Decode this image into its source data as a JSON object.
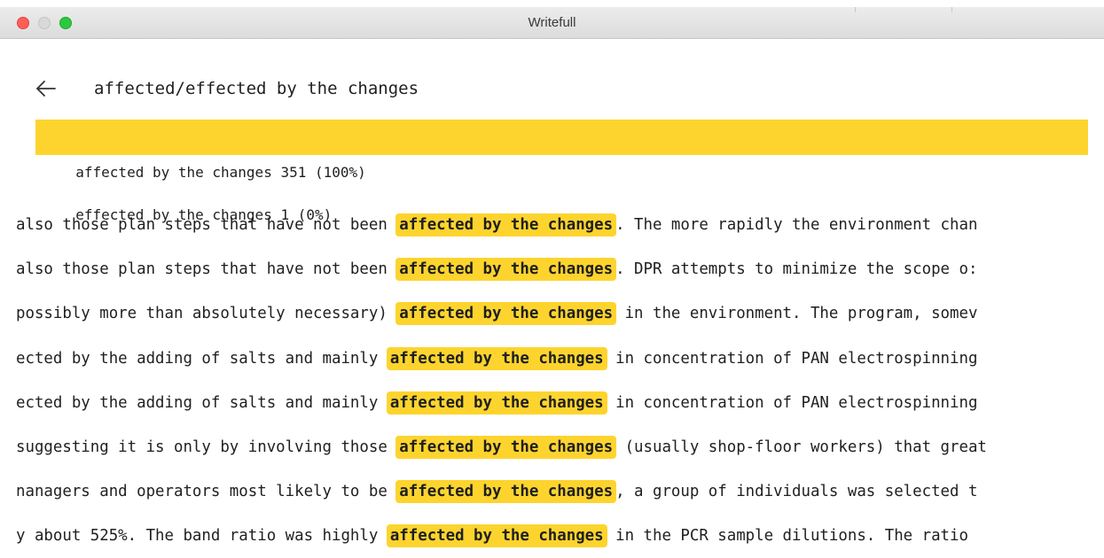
{
  "window": {
    "title": "Writefull",
    "colors": {
      "close": "#fd5f57",
      "minimize": "#d9d9d9",
      "zoom": "#2cc840"
    }
  },
  "header": {
    "back_icon": "left-arrow-icon",
    "query": "affected/effected by the changes"
  },
  "options": [
    {
      "label": "affected by the changes 351 (100%)",
      "selected": true
    },
    {
      "label": "effected by the changes 1 (0%)",
      "selected": false
    }
  ],
  "highlight_color": "#fdd42e",
  "examples": [
    {
      "before": "also those plan steps that have not been ",
      "match": "affected by the changes",
      "after": ". The more rapidly the environment chan"
    },
    {
      "before": "also those plan steps that have not been ",
      "match": "affected by the changes",
      "after": ". DPR attempts to minimize the scope o:"
    },
    {
      "before": "possibly more than absolutely necessary) ",
      "match": "affected by the changes",
      "after": " in the environment. The program, somev"
    },
    {
      "before": "ected by the adding of salts and mainly ",
      "match": "affected by the changes",
      "after": " in concentration of PAN electrospinning"
    },
    {
      "before": "ected by the adding of salts and mainly ",
      "match": "affected by the changes",
      "after": " in concentration of PAN electrospinning"
    },
    {
      "before": "suggesting it is only by involving those ",
      "match": "affected by the changes",
      "after": " (usually shop-floor workers) that great"
    },
    {
      "before": "nanagers and operators most likely to be ",
      "match": "affected by the changes",
      "after": ", a group of individuals was selected t"
    },
    {
      "before": "y about 525%. The band ratio was highly ",
      "match": "affected by the changes",
      "after": " in the PCR sample dilutions. The ratio"
    }
  ]
}
